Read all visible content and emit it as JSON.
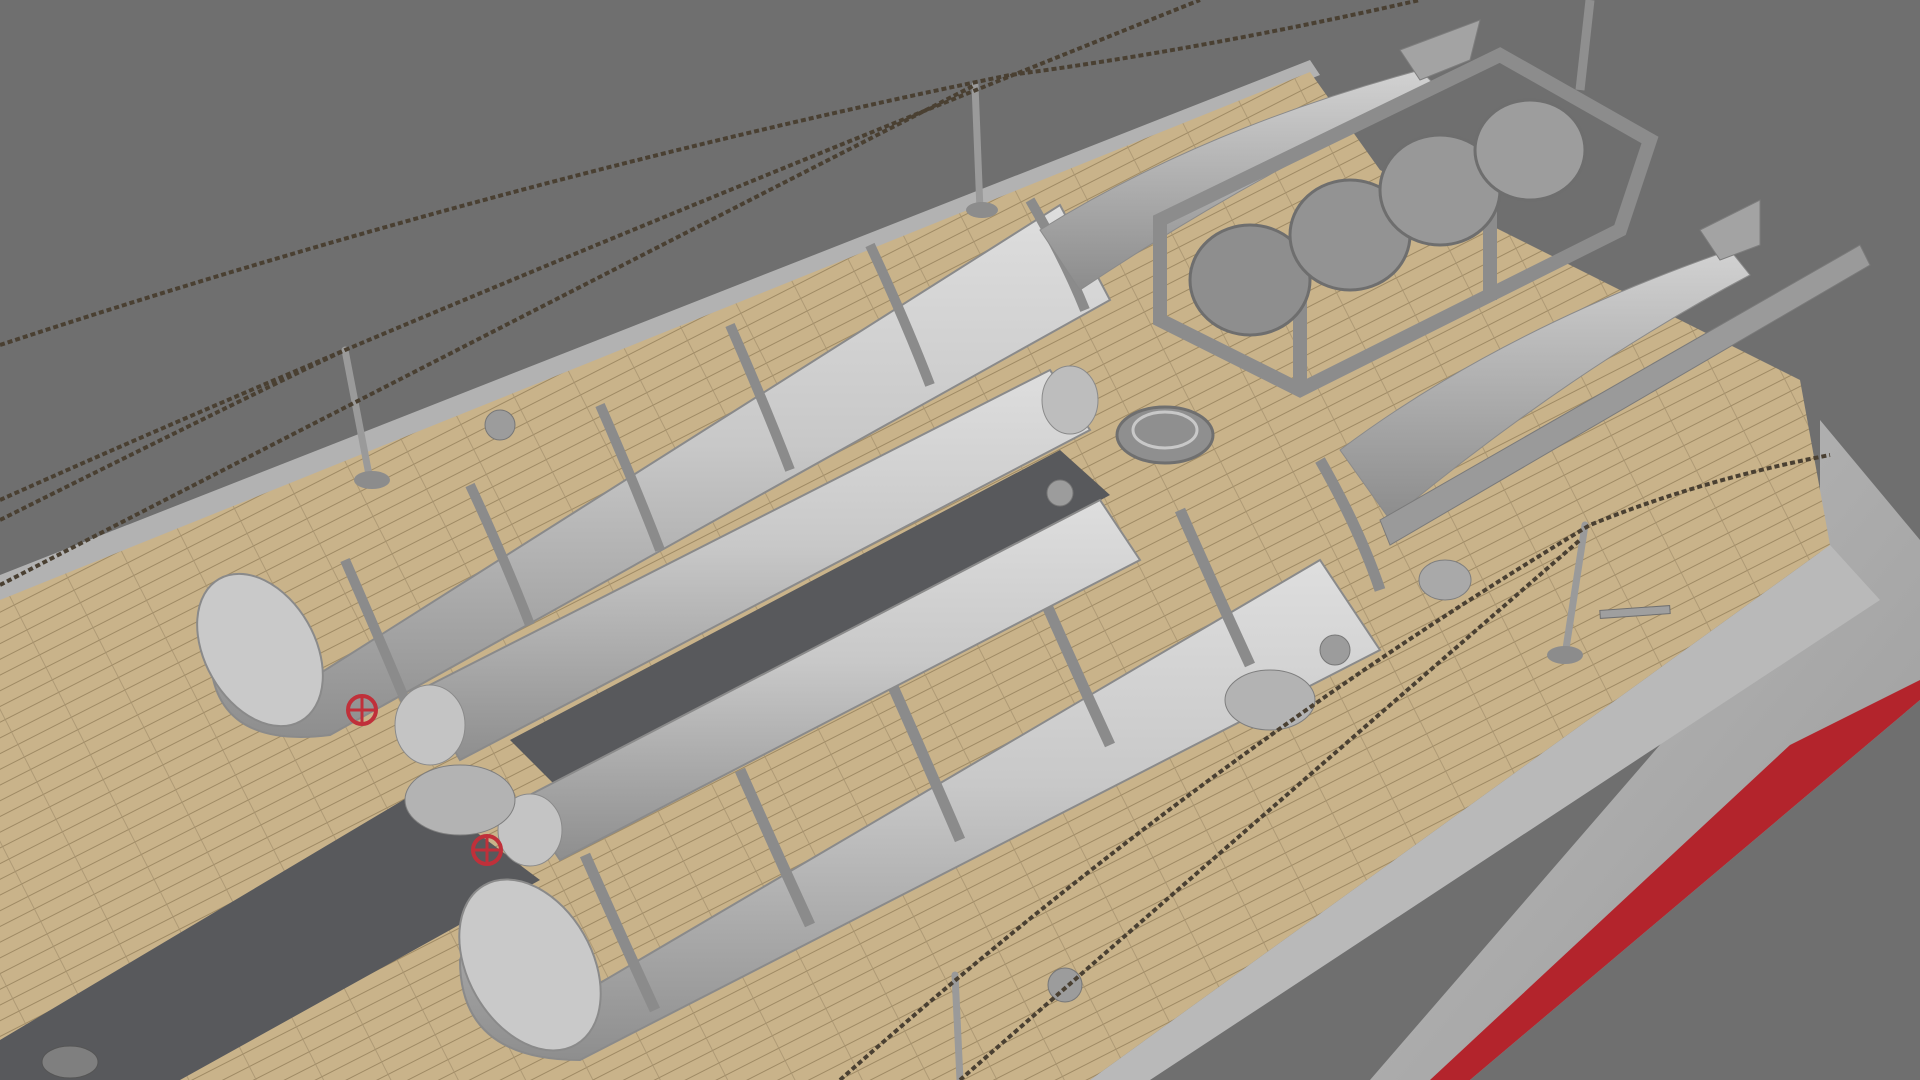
{
  "scene": {
    "subject": "torpedo-boat-deck-render",
    "colors": {
      "background": "#6f6f6f",
      "deck_wood": "#c9b38a",
      "deck_wood_dark": "#a89470",
      "hull": "#b5b5b5",
      "hull_side": "#9d9d9d",
      "boot_stripe": "#b3242c",
      "metal_light": "#cfcfcf",
      "metal_mid": "#a9a9a9",
      "metal_dark": "#7c7c7c",
      "mat": "#58595c",
      "chain": "#4a4032",
      "valve_red": "#c0303a"
    }
  }
}
